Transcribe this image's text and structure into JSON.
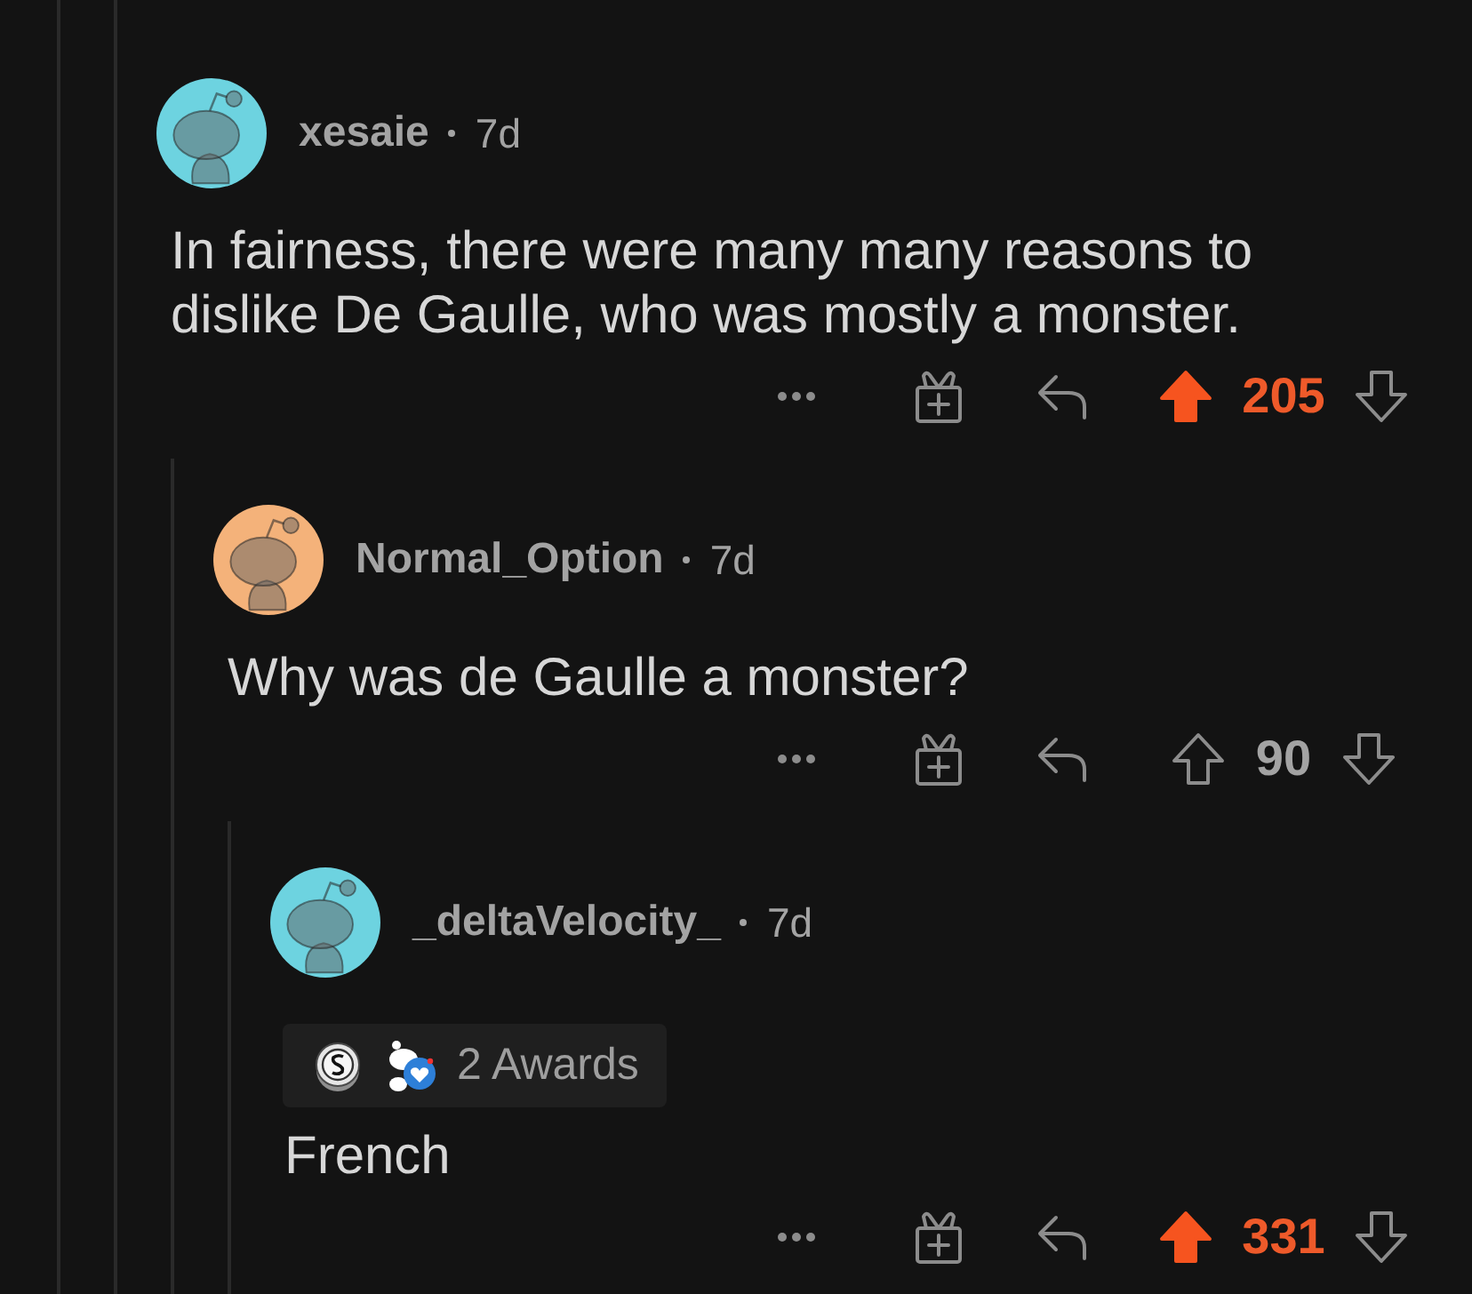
{
  "comments": [
    {
      "author": "xesaie",
      "avatar": {
        "color": "#6dd3e0"
      },
      "age": "7d",
      "body": "In fairness, there were many many reasons to dislike De Gaulle, who was mostly a monster.",
      "score": "205",
      "upvoted": true,
      "downvoted": false,
      "children": [
        {
          "author": "Normal_Option",
          "avatar": {
            "color": "#f4b27a"
          },
          "age": "7d",
          "body": "Why was de Gaulle a monster?",
          "score": "90",
          "upvoted": false,
          "downvoted": false,
          "children": [
            {
              "author": "_deltaVelocity_",
              "avatar": {
                "color": "#6dd3e0"
              },
              "age": "7d",
              "awards": {
                "label": "2 Awards",
                "items": [
                  {
                    "kind": "coin"
                  },
                  {
                    "kind": "mascot"
                  }
                ]
              },
              "body": "French",
              "score": "331",
              "upvoted": true,
              "downvoted": false
            }
          ]
        }
      ]
    }
  ]
}
